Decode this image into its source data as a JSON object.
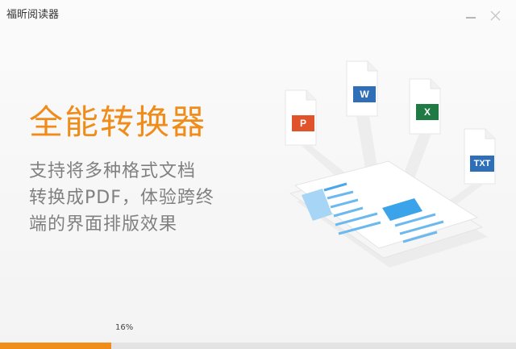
{
  "window": {
    "title": "福昕阅读器",
    "minimize_icon": "minimize-icon",
    "close_icon": "close-icon"
  },
  "hero": {
    "headline": "全能转换器",
    "description_lines": [
      "支持将多种格式文档",
      "转换成PDF，体验跨终",
      "端的界面排版效果"
    ]
  },
  "illustration": {
    "file_badges": {
      "ppt": "P",
      "word": "W",
      "excel": "X",
      "txt": "TXT"
    },
    "badge_colors": {
      "ppt": "#e1532b",
      "word": "#2f6fb8",
      "excel": "#1f7a44",
      "txt": "#2f6fb8"
    }
  },
  "progress": {
    "label": "16%",
    "value": 0.216,
    "color": "#f08c1a"
  },
  "colors": {
    "accent": "#f08c1a",
    "text_gray": "#808080"
  }
}
